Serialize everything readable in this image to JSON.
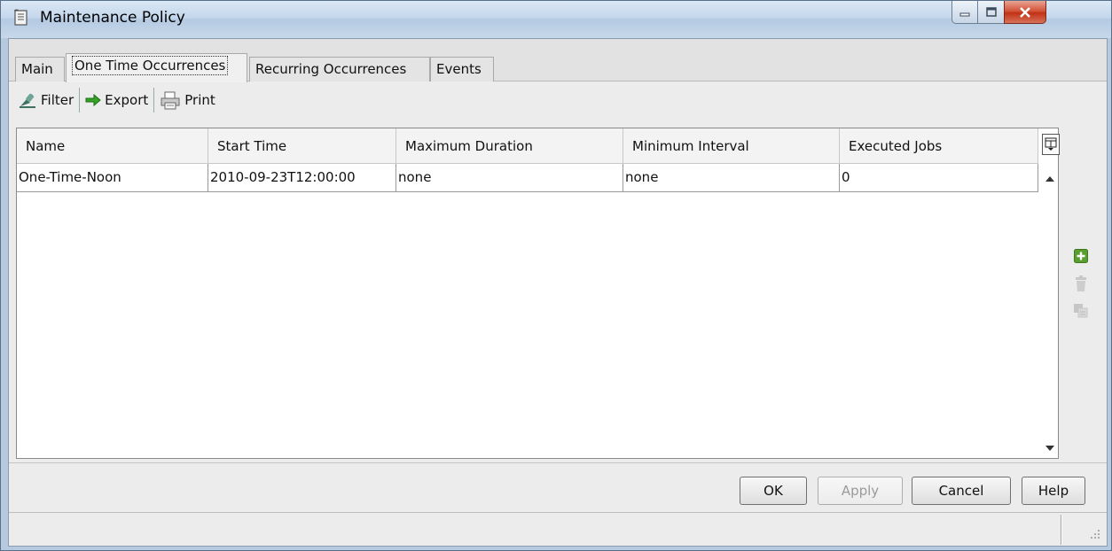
{
  "window": {
    "title": "Maintenance Policy",
    "icon": "scroll-icon",
    "controls": [
      "minimize-icon",
      "maximize-icon",
      "close-icon"
    ]
  },
  "tabs": [
    {
      "label": "Main",
      "active": false
    },
    {
      "label": "One Time Occurrences",
      "active": true
    },
    {
      "label": "Recurring Occurrences",
      "active": false
    },
    {
      "label": "Events",
      "active": false
    }
  ],
  "toolbar": {
    "filter_label": "Filter",
    "export_label": "Export",
    "print_label": "Print"
  },
  "table": {
    "columns": [
      "Name",
      "Start Time",
      "Maximum Duration",
      "Minimum Interval",
      "Executed Jobs"
    ],
    "rows": [
      [
        "One-Time-Noon",
        "2010-09-23T12:00:00",
        "none",
        "none",
        "0"
      ]
    ]
  },
  "side_actions": {
    "add": "plus-icon",
    "delete": "trash-icon",
    "copy": "copy-icon"
  },
  "buttons": {
    "ok": "OK",
    "apply": "Apply",
    "cancel": "Cancel",
    "help": "Help"
  },
  "colors": {
    "add_green": "#5a9e2f",
    "export_green": "#34a327"
  }
}
